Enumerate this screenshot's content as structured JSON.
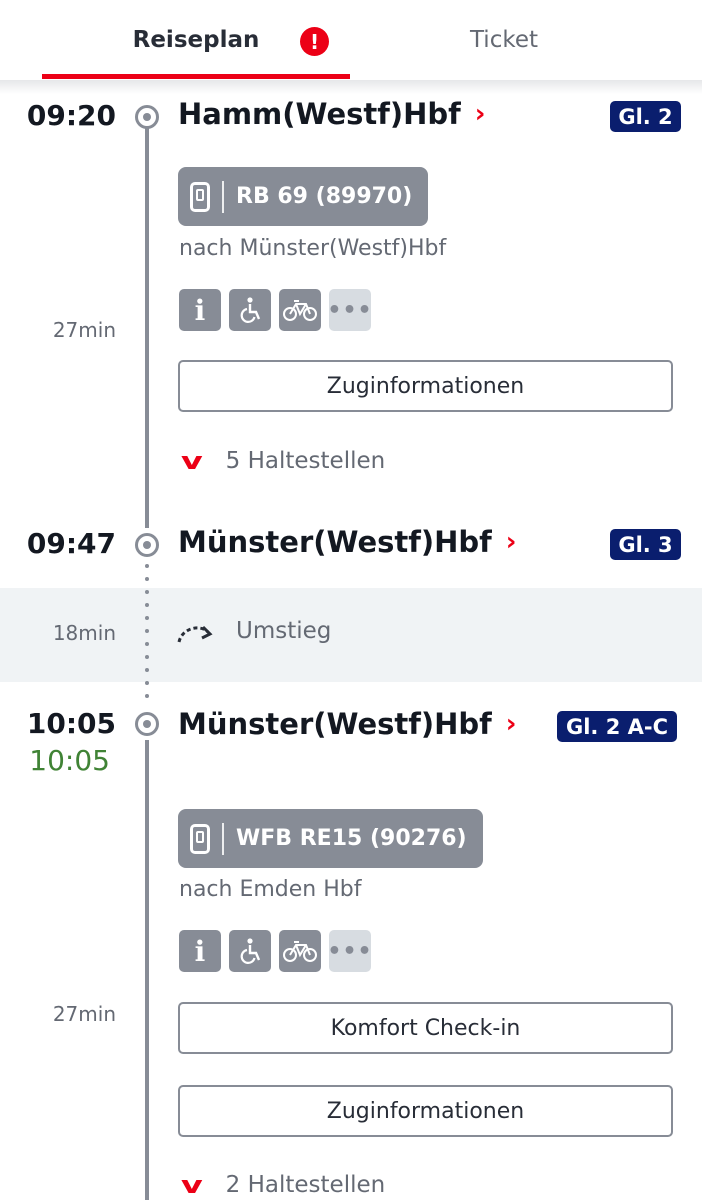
{
  "tabs": {
    "reiseplan_label": "Reiseplan",
    "ticket_label": "Ticket",
    "warning_glyph": "!"
  },
  "colors": {
    "accent_red": "#ec0016",
    "platform_navy": "#0a1e6e",
    "realtime_green": "#408335",
    "neutral_grey": "#878c96"
  },
  "legs": [
    {
      "departure": {
        "time": "09:20",
        "station": "Hamm(Westf)Hbf",
        "platform": "Gl. 2"
      },
      "train": {
        "name": "RB 69 (89970)",
        "direction": "nach Münster(Westf)Hbf",
        "icon": "train-icon"
      },
      "duration": "27min",
      "attributes": [
        "info-icon",
        "wheelchair-icon",
        "bicycle-icon",
        "more-icon"
      ],
      "buttons": [
        "Zuginformationen"
      ],
      "stops": "5 Haltestellen",
      "arrival": {
        "time": "09:47",
        "station": "Münster(Westf)Hbf",
        "platform": "Gl. 3"
      }
    },
    {
      "departure": {
        "time": "10:05",
        "realtime": "10:05",
        "station": "Münster(Westf)Hbf",
        "platform": "Gl. 2 A-C"
      },
      "train": {
        "name": "WFB RE15 (90276)",
        "direction": "nach Emden Hbf",
        "icon": "train-icon"
      },
      "duration": "27min",
      "attributes": [
        "info-icon",
        "wheelchair-icon",
        "bicycle-icon",
        "more-icon"
      ],
      "buttons": [
        "Komfort Check-in",
        "Zuginformationen"
      ],
      "stops": "2 Haltestellen"
    }
  ],
  "transfer": {
    "duration": "18min",
    "label": "Umstieg"
  },
  "glyphs": {
    "chevron_right": "›",
    "chevron_down": "v",
    "more": "•••",
    "info": "i"
  }
}
